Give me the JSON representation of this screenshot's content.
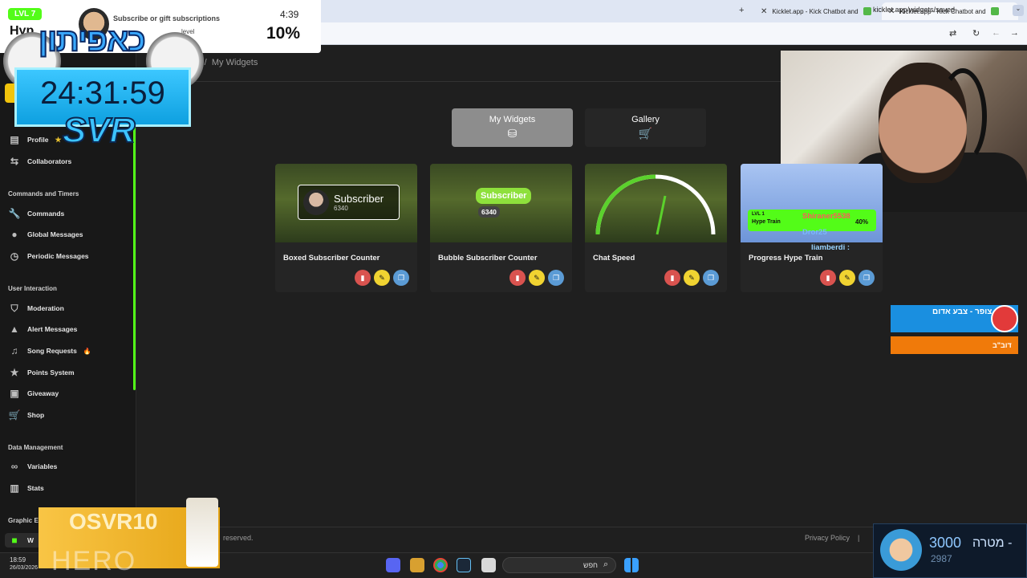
{
  "browser": {
    "tabs": [
      {
        "title": "Kicklet.app - Kick Chatbot and"
      },
      {
        "title": "Kicklet.app - Kick Chatbot and"
      }
    ],
    "url": "kicklet.app/widgets/saved"
  },
  "breadcrumb": {
    "parent_fragment": "s",
    "separator": "/",
    "current": "My Widgets"
  },
  "sidebar": {
    "items_top": [
      {
        "label": "Profile",
        "icon": "profile-icon"
      },
      {
        "label": "Collaborators",
        "icon": "collaborators-icon"
      }
    ],
    "sections": [
      {
        "title": "Commands and Timers",
        "items": [
          {
            "label": "Commands",
            "icon": "wrench-icon"
          },
          {
            "label": "Global Messages",
            "icon": "chat-icon"
          },
          {
            "label": "Periodic Messages",
            "icon": "clock-icon"
          }
        ]
      },
      {
        "title": "User Interaction",
        "items": [
          {
            "label": "Moderation",
            "icon": "shield-icon"
          },
          {
            "label": "Alert Messages",
            "icon": "warning-icon"
          },
          {
            "label": "Song Requests",
            "icon": "music-icon",
            "badge": "🔥"
          },
          {
            "label": "Points System",
            "icon": "star-icon"
          },
          {
            "label": "Giveaway",
            "icon": "gift-icon"
          },
          {
            "label": "Shop",
            "icon": "cart-icon"
          }
        ]
      },
      {
        "title": "Data Management",
        "items": [
          {
            "label": "Variables",
            "icon": "link-icon"
          },
          {
            "label": "Stats",
            "icon": "chart-icon"
          }
        ]
      }
    ],
    "section_graphic_fragment": "Graphic E",
    "active_item_fragment": "W"
  },
  "toggle": {
    "my_widgets": "My Widgets",
    "gallery": "Gallery"
  },
  "widgets": [
    {
      "title": "Boxed Subscriber Counter",
      "preview_label": "Subscriber",
      "preview_count": "6340"
    },
    {
      "title": "Bubble Subscriber Counter",
      "preview_label": "Subscriber",
      "preview_count": "6340"
    },
    {
      "title": "Chat Speed"
    },
    {
      "title": "Progress Hype Train"
    }
  ],
  "footer": {
    "rights": "reserved.",
    "privacy": "Privacy Policy",
    "sep": "|"
  },
  "taskbar": {
    "time": "18:59",
    "date": "26/03/2026",
    "search_placeholder": "חפש"
  },
  "overlay": {
    "sub": {
      "lvl": "LVL 7",
      "hyp": "Hyp",
      "text": "Subscribe or gift subscriptions",
      "level_fragment": "level",
      "time": "4:39",
      "percent": "10%"
    },
    "logo_he": "כאפיתון",
    "timer": "24:31:59",
    "svr": "SVR",
    "hype_train": {
      "lvl": "LVL 1",
      "name": "Hype Train",
      "percent": "40%"
    },
    "chat": [
      "Shiraner5538",
      "Dror25",
      "liamberdi :"
    ],
    "alert1": "צופר - צבע אדום",
    "alert2": "דוב\"ב",
    "goal": {
      "label": "מטרה -",
      "target": "3000",
      "current": "2987"
    },
    "promo": {
      "code": "OSVR10",
      "brand": "HERO"
    }
  },
  "colors": {
    "accent": "#53fc18",
    "card": "#252525",
    "bg": "#1f1f1f"
  }
}
